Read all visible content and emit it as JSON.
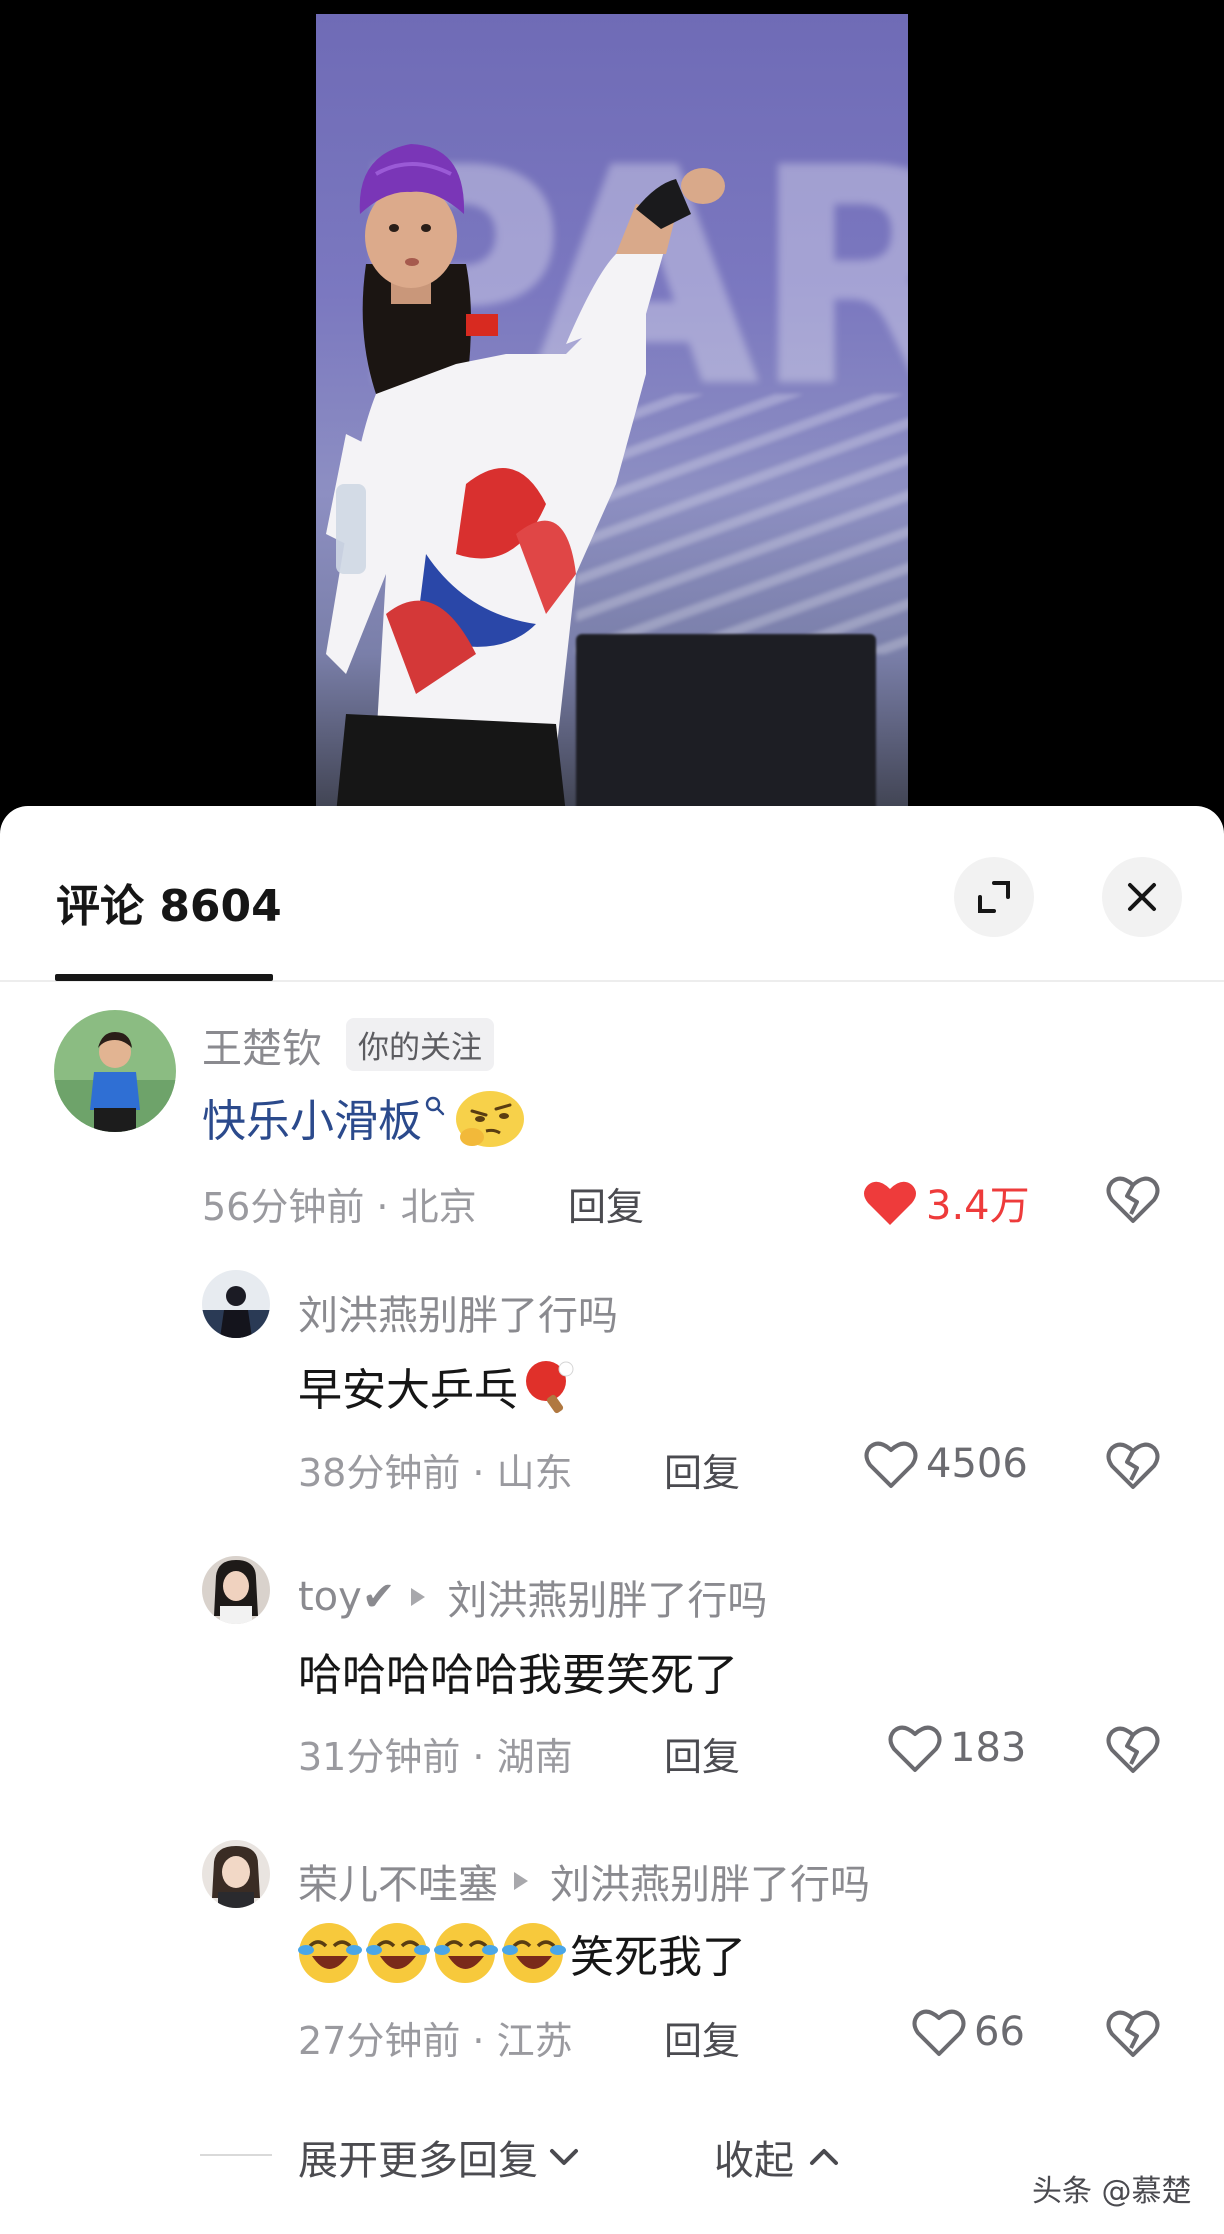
{
  "sheet": {
    "title": "评论 8604"
  },
  "comments": [
    {
      "username": "王楚钦",
      "badge": "你的关注",
      "content": "快乐小滑板",
      "time_location": "56分钟前 · 北京",
      "reply_label": "回复",
      "likes": "3.4万",
      "liked": true
    },
    {
      "username": "刘洪燕别胖了行吗",
      "content": "早安大乒乓",
      "time_location": "38分钟前 · 山东",
      "reply_label": "回复",
      "likes": "4506"
    },
    {
      "username": "toy✔",
      "reply_to": "刘洪燕别胖了行吗",
      "content": "哈哈哈哈哈我要笑死了",
      "time_location": "31分钟前 · 湖南",
      "reply_label": "回复",
      "likes": "183"
    },
    {
      "username": "荣儿不哇塞",
      "reply_to": "刘洪燕别胖了行吗",
      "content": "笑死我了",
      "time_location": "27分钟前 · 江苏",
      "reply_label": "回复",
      "likes": "66"
    }
  ],
  "footer": {
    "expand_more": "展开更多回复",
    "collapse": "收起"
  },
  "watermark": "头条 @慕楚",
  "colors": {
    "like_active": "#ee3b3b",
    "link_text": "#2b4a8c",
    "secondary_text": "#8a8a8f"
  },
  "icons": [
    "expand-icon",
    "close-icon",
    "search-icon",
    "heart-icon",
    "broken-heart-icon",
    "ping-pong-icon",
    "laughing-emoji-icon",
    "thinking-emoji-icon",
    "chevron-down-icon",
    "chevron-up-icon"
  ]
}
